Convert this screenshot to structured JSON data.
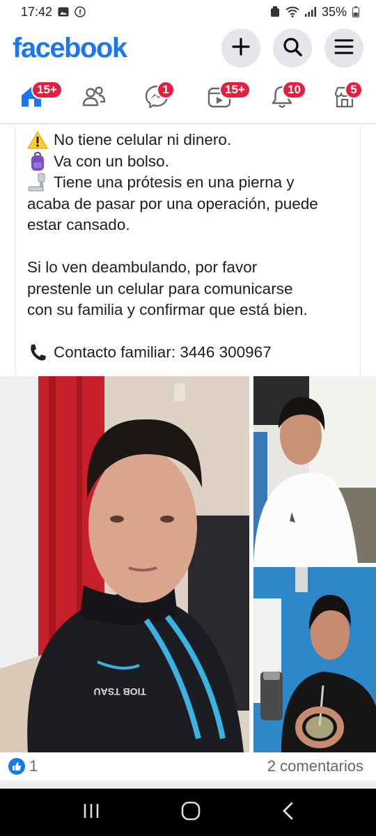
{
  "status_bar": {
    "time": "17:42",
    "battery": "35%"
  },
  "header": {
    "logo": "facebook",
    "buttons": [
      {
        "name": "create",
        "icon": "plus-icon"
      },
      {
        "name": "search",
        "icon": "search-icon"
      },
      {
        "name": "menu",
        "icon": "menu-icon"
      }
    ]
  },
  "nav": {
    "tabs": [
      {
        "name": "home",
        "icon": "home-icon",
        "badge": "15+"
      },
      {
        "name": "friends",
        "icon": "friends-icon",
        "badge": ""
      },
      {
        "name": "messenger",
        "icon": "messenger-icon",
        "badge": "1"
      },
      {
        "name": "video",
        "icon": "video-icon",
        "badge": "15+"
      },
      {
        "name": "notifications",
        "icon": "bell-icon",
        "badge": "10"
      },
      {
        "name": "marketplace",
        "icon": "marketplace-icon",
        "badge": "5"
      }
    ],
    "accent": "#1877f2",
    "badge_color": "#e41e3f"
  },
  "post": {
    "lines": [
      {
        "emoji": "warning-icon",
        "text": "No tiene celular ni dinero."
      },
      {
        "emoji": "backpack-icon",
        "text": "Va con un bolso."
      },
      {
        "emoji": "prosthetic-leg-icon",
        "text": "Tiene una prótesis en una pierna y"
      },
      {
        "emoji": "",
        "text": "acaba de pasar por una operación, puede"
      },
      {
        "emoji": "",
        "text": "estar cansado."
      }
    ],
    "paragraph2": [
      "Si lo ven deambulando, por favor",
      "prestenle un celular para comunicarse",
      "con su familia y confirmar que está bien."
    ],
    "contact": {
      "emoji": "telephone-icon",
      "text": "Contacto familiar: 3446 300967"
    }
  },
  "photos": [
    {
      "name": "photo-main",
      "description_icon": "person-photo"
    },
    {
      "name": "photo-top-right",
      "description_icon": "person-photo"
    },
    {
      "name": "photo-bottom-right",
      "description_icon": "person-photo"
    }
  ],
  "reactions": {
    "like_count": "1",
    "comments": "2 comentarios"
  }
}
